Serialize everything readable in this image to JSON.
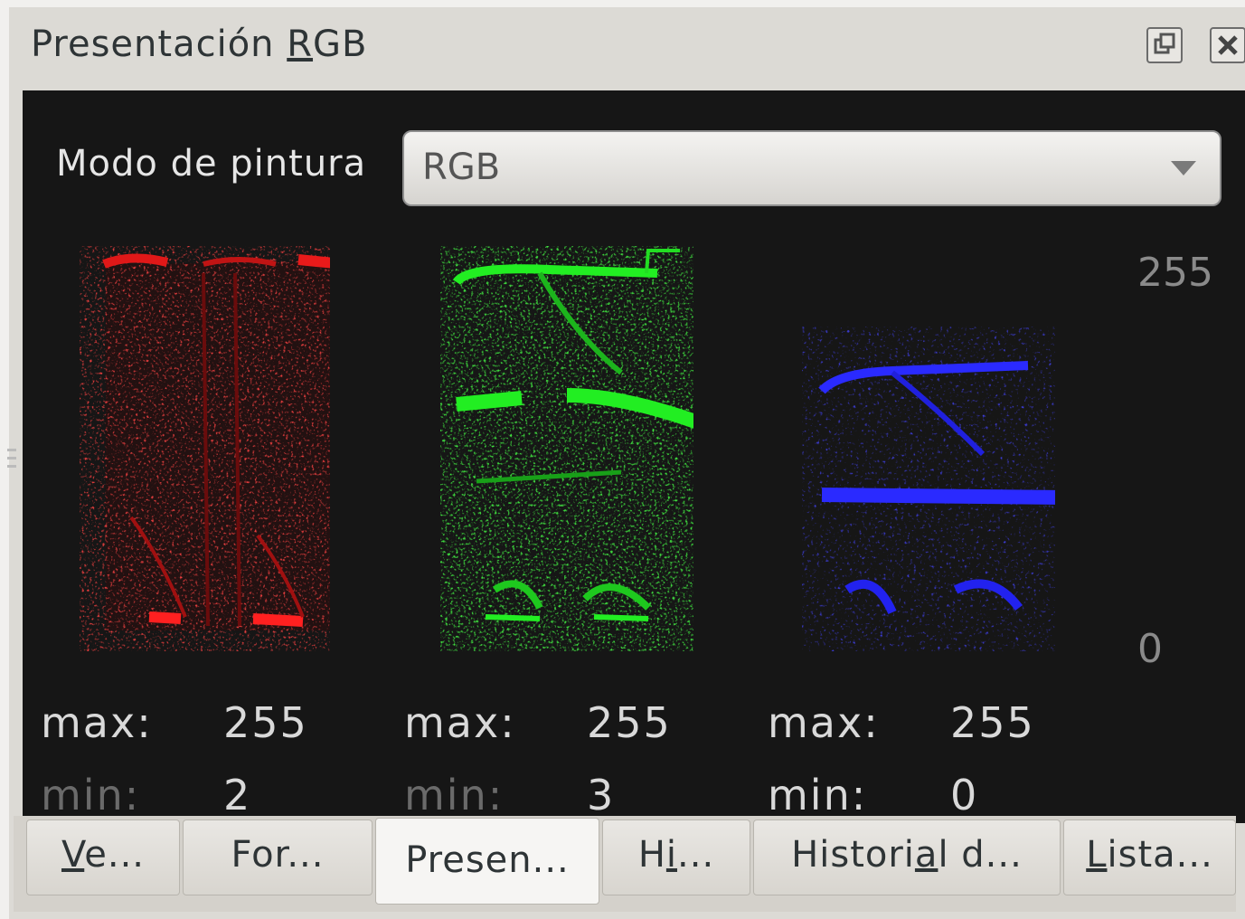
{
  "window": {
    "title_parts": [
      "Presentación ",
      "R",
      "GB"
    ],
    "float_icon": "float-icon",
    "close_icon": "close-icon"
  },
  "paint_mode": {
    "label": "Modo de pintura",
    "value": "RGB"
  },
  "scale": {
    "top": "255",
    "bottom": "0"
  },
  "channels": [
    {
      "name": "red",
      "color": "#ff2020",
      "max_label": "max:",
      "max_value": "255",
      "min_label": "min:",
      "min_value": "2"
    },
    {
      "name": "green",
      "color": "#22ee22",
      "max_label": "max:",
      "max_value": "255",
      "min_label": "min:",
      "min_value": "3"
    },
    {
      "name": "blue",
      "color": "#2a2aff",
      "max_label": "max:",
      "max_value": "255",
      "min_label": "min:",
      "min_value": "0"
    }
  ],
  "tabs": [
    {
      "pre": "",
      "u": "V",
      "post": "e..."
    },
    {
      "pre": "For...",
      "u": "",
      "post": ""
    },
    {
      "pre": "Presen...",
      "u": "",
      "post": ""
    },
    {
      "pre": "H",
      "u": "i",
      "post": "..."
    },
    {
      "pre": "Histori",
      "u": "a",
      "post": "l d..."
    },
    {
      "pre": "",
      "u": "L",
      "post": "ista..."
    }
  ],
  "active_tab": 2
}
